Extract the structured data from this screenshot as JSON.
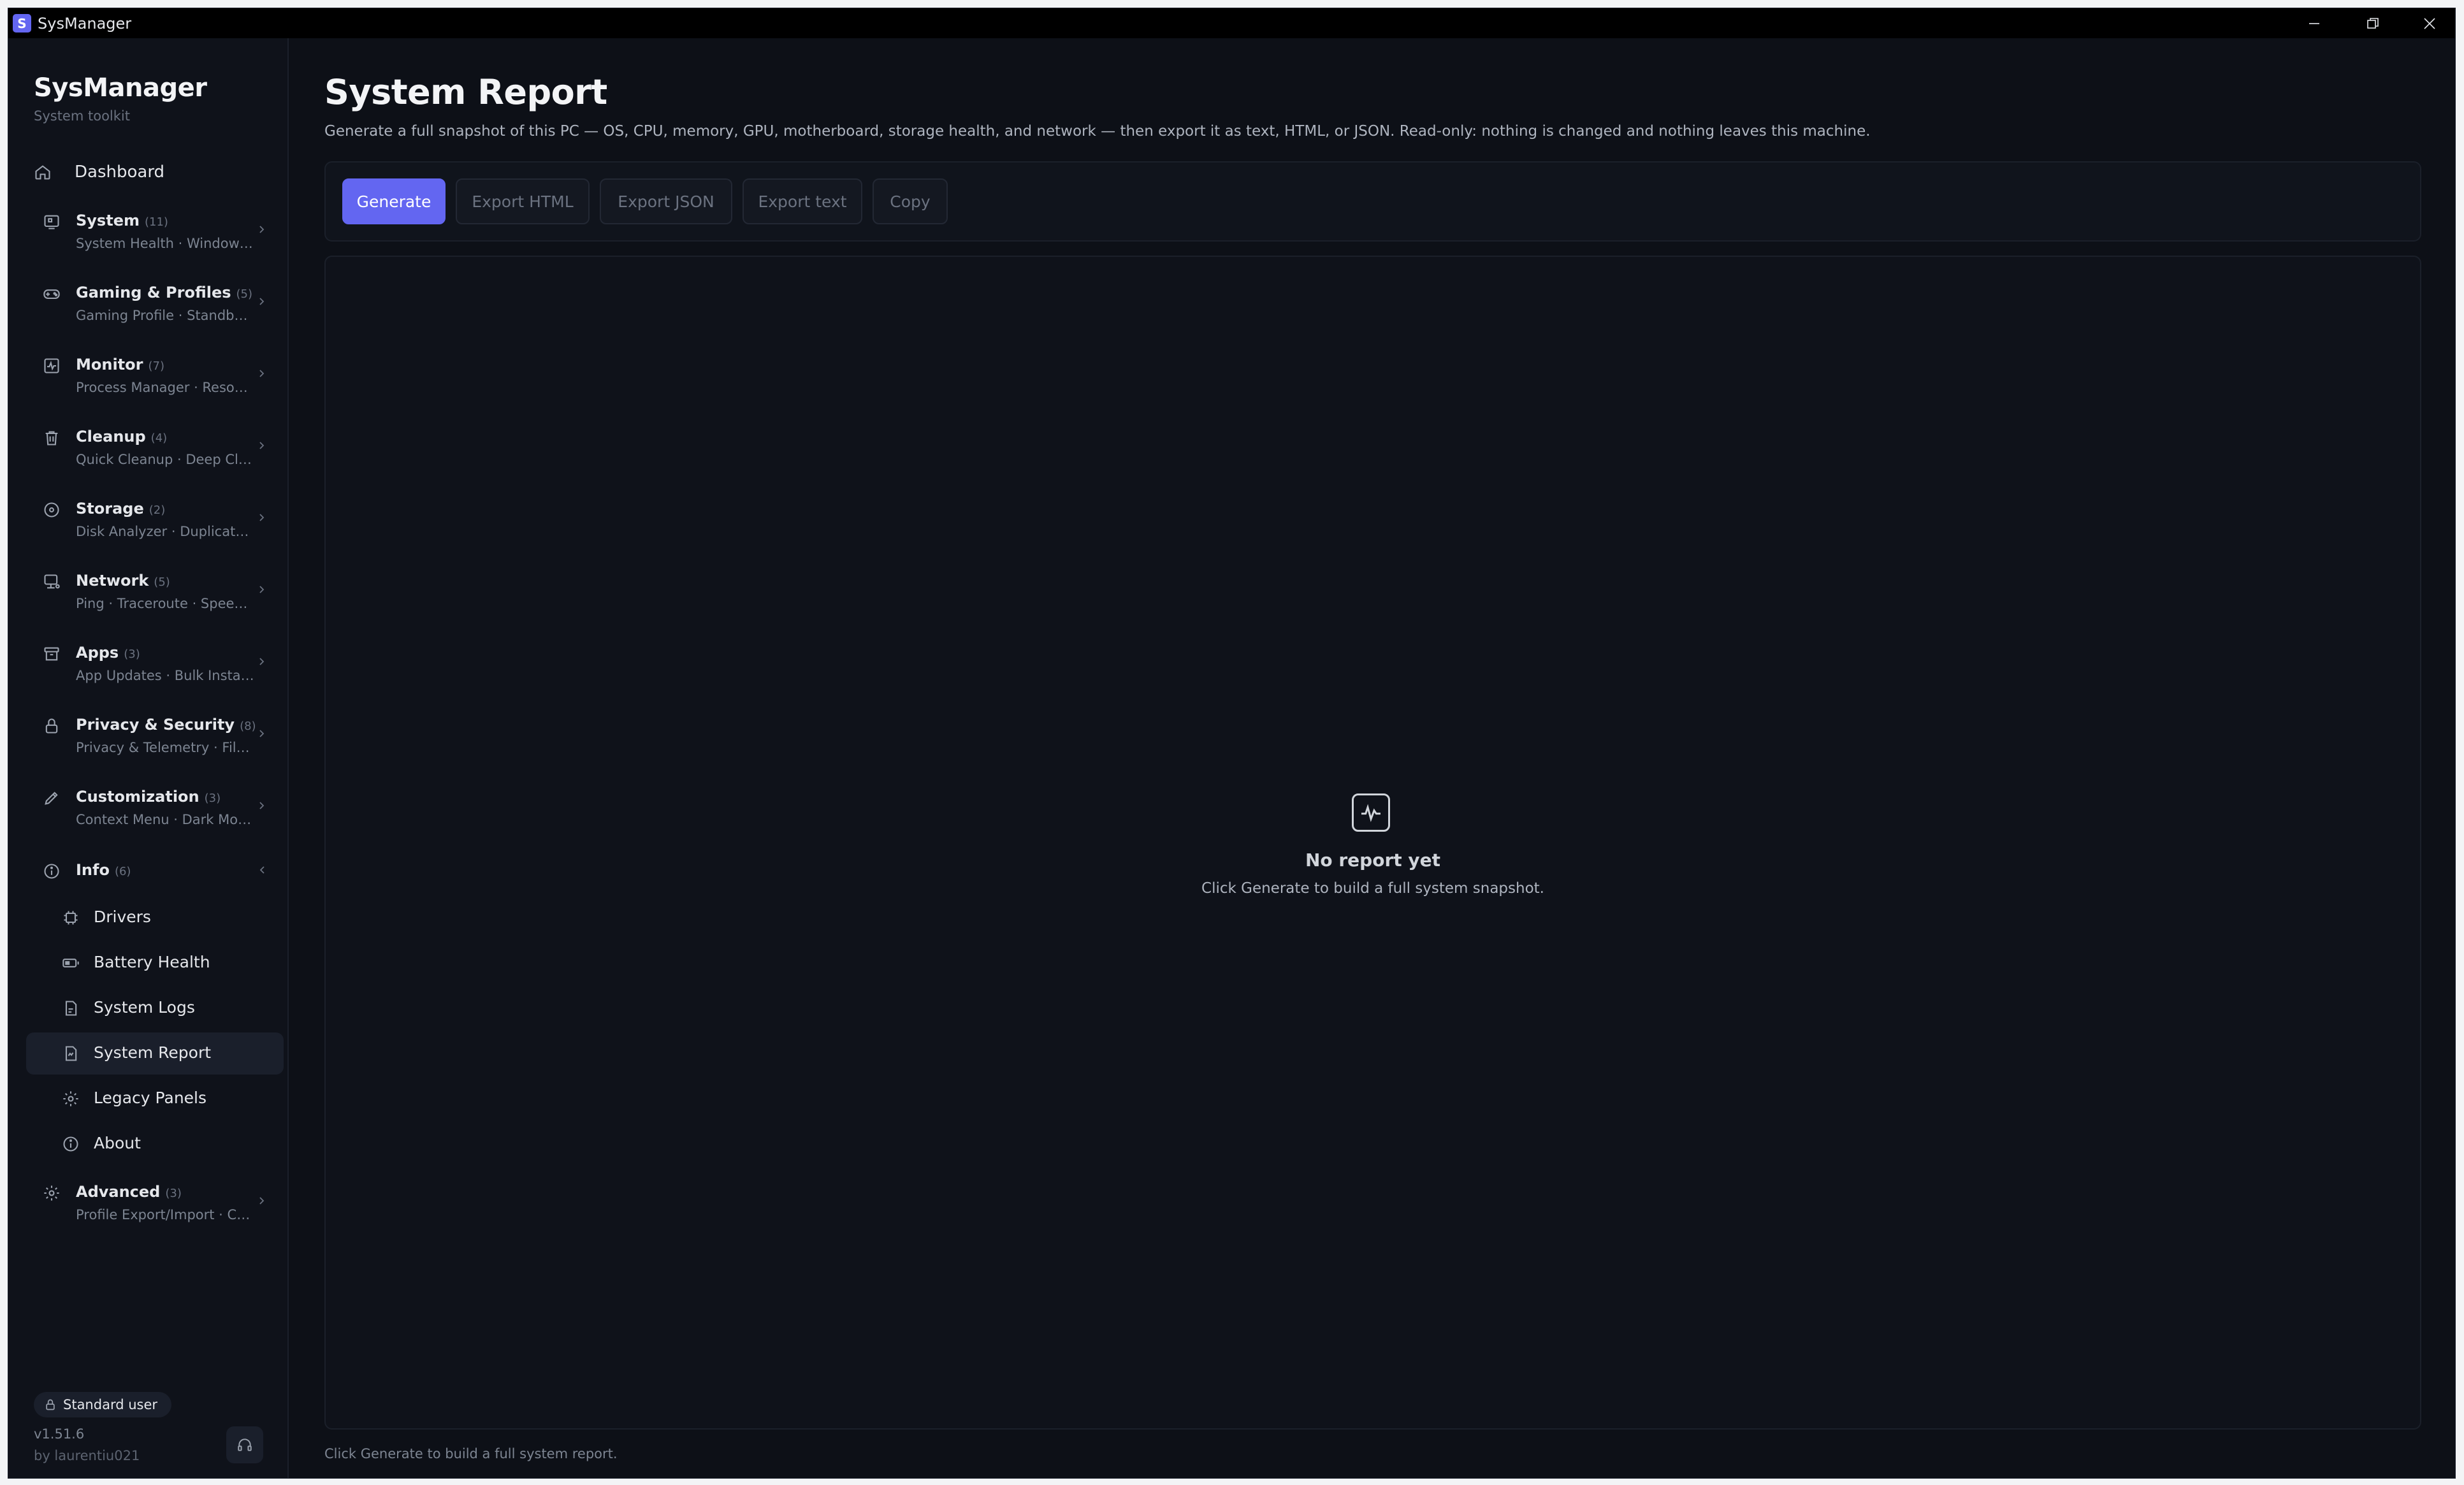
{
  "window": {
    "title": "SysManager",
    "app_icon_letter": "S"
  },
  "brand": {
    "name": "SysManager",
    "tagline": "System toolkit"
  },
  "nav": {
    "dashboard": {
      "label": "Dashboard"
    },
    "groups": [
      {
        "label": "System",
        "count": "(11)",
        "sub": "System Health · Windows..."
      },
      {
        "label": "Gaming & Profiles",
        "count": "(5)",
        "sub": "Gaming Profile · Standby L..."
      },
      {
        "label": "Monitor",
        "count": "(7)",
        "sub": "Process Manager · Resourc..."
      },
      {
        "label": "Cleanup",
        "count": "(4)",
        "sub": "Quick Cleanup · Deep Clea..."
      },
      {
        "label": "Storage",
        "count": "(2)",
        "sub": "Disk Analyzer · Duplicate F..."
      },
      {
        "label": "Network",
        "count": "(5)",
        "sub": "Ping · Traceroute · Speed T..."
      },
      {
        "label": "Apps",
        "count": "(3)",
        "sub": "App Updates · Bulk Installe..."
      },
      {
        "label": "Privacy & Security",
        "count": "(8)",
        "sub": "Privacy & Telemetry · File S..."
      },
      {
        "label": "Customization",
        "count": "(3)",
        "sub": "Context Menu · Dark Mod..."
      }
    ],
    "info": {
      "label": "Info",
      "count": "(6)",
      "children": [
        {
          "label": "Drivers"
        },
        {
          "label": "Battery Health"
        },
        {
          "label": "System Logs"
        },
        {
          "label": "System Report"
        },
        {
          "label": "Legacy Panels"
        },
        {
          "label": "About"
        }
      ]
    },
    "advanced": {
      "label": "Advanced",
      "count": "(3)",
      "sub": "Profile Export/Import · CLI..."
    }
  },
  "sidebar_footer": {
    "user_role": "Standard user",
    "version": "v1.51.6",
    "author": "by laurentiu021"
  },
  "page": {
    "title": "System Report",
    "description": "Generate a full snapshot of this PC — OS, CPU, memory, GPU, motherboard, storage health, and network — then export it as text, HTML, or JSON. Read-only: nothing is changed and nothing leaves this machine."
  },
  "toolbar": {
    "generate": "Generate",
    "export_html": "Export HTML",
    "export_json": "Export JSON",
    "export_text": "Export text",
    "copy": "Copy"
  },
  "empty_state": {
    "title": "No report yet",
    "hint": "Click Generate to build a full system snapshot."
  },
  "status": "Click Generate to build a full system report.",
  "colors": {
    "accent": "#6366f1",
    "background": "#0d1017",
    "sidebar": "#0f121a"
  }
}
